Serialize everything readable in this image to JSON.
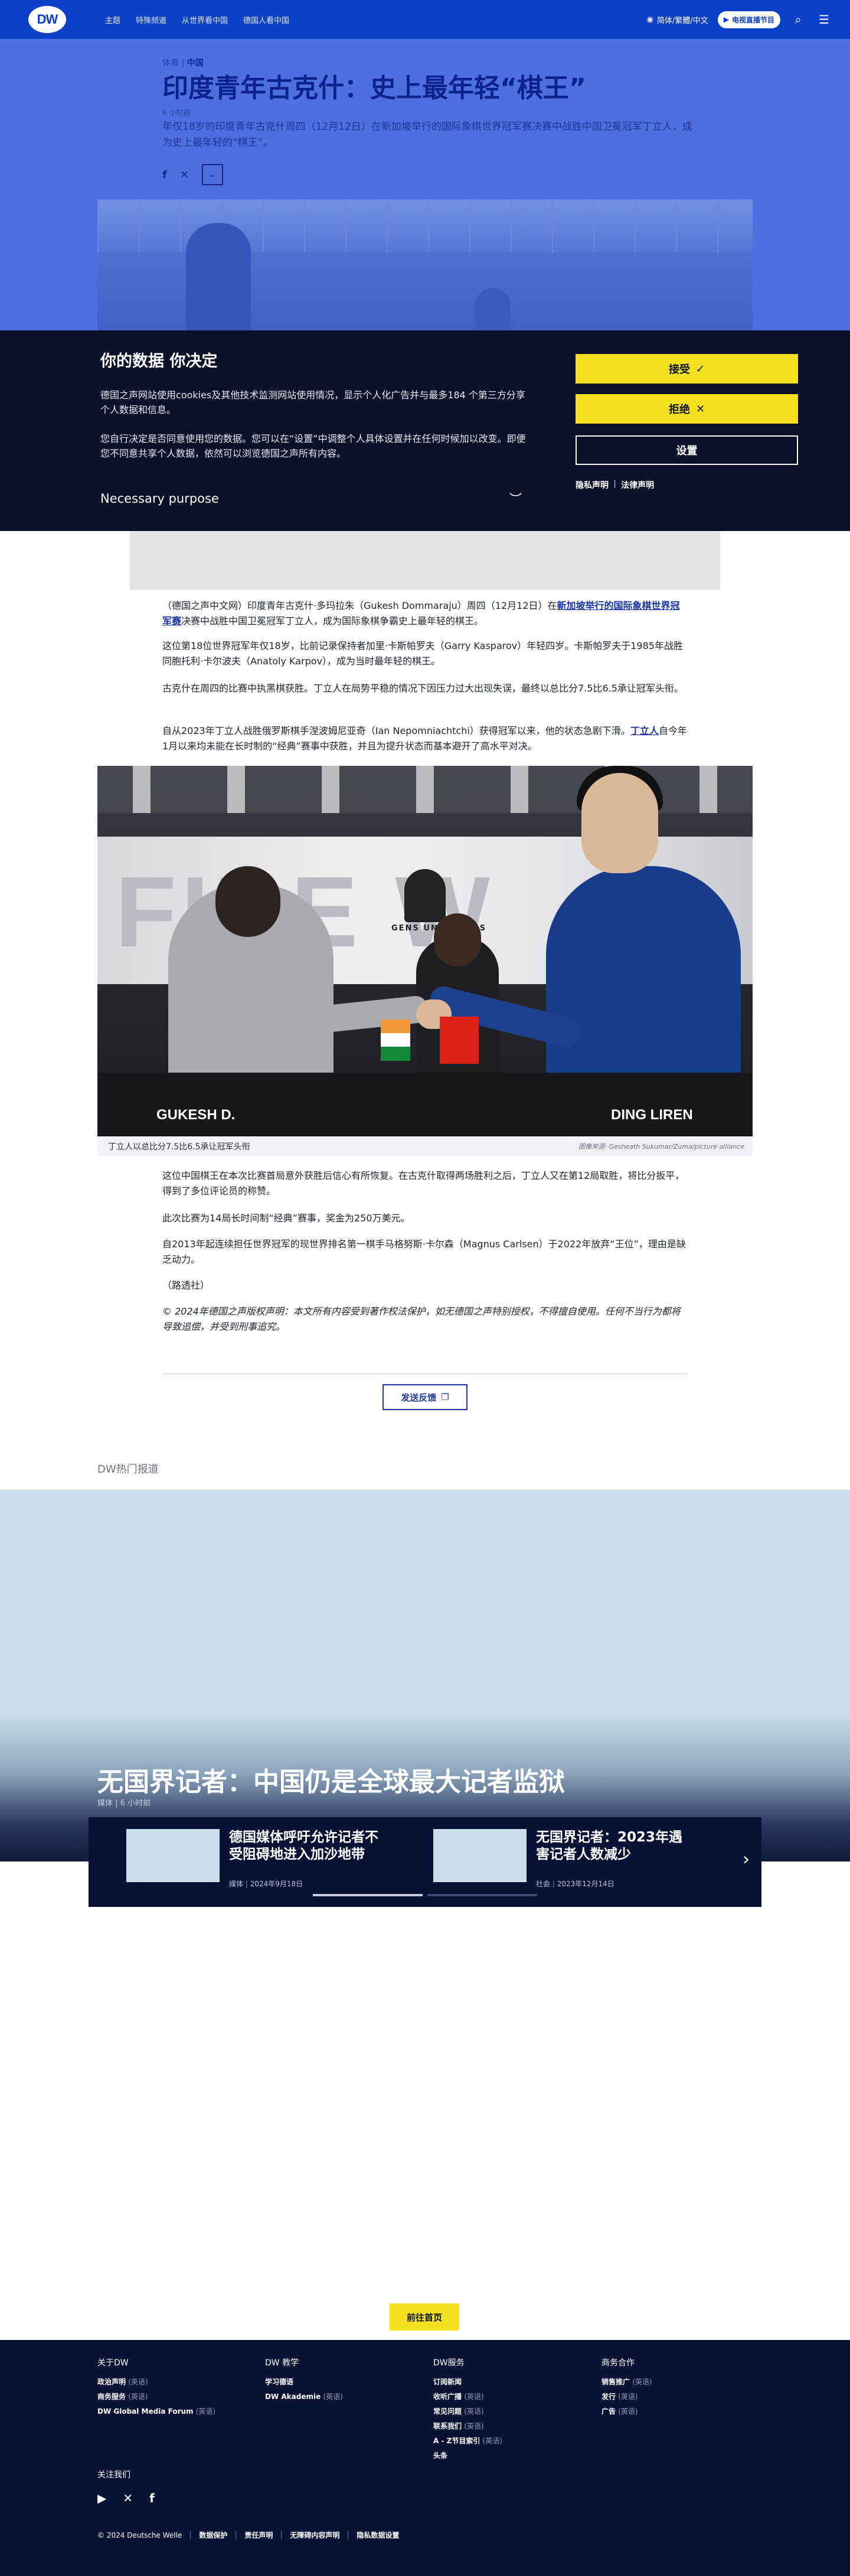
{
  "header": {
    "logo": "DW",
    "nav": [
      "主题",
      "特殊频道",
      "从世界看中国",
      "德国人看中国"
    ],
    "lang_label": "简体/繁體/中文",
    "tv_label": "电视直播节目",
    "search_icon": "search-icon",
    "menu_icon": "menu-icon"
  },
  "article": {
    "category": "体育",
    "region": "中国",
    "title": "印度青年古克什：史上最年轻“棋王”",
    "time": "6 小时前",
    "lead": "年仅18岁的印度青年古克什周四（12月12日）在新加坡举行的国际象棋世界冠军赛决赛中战胜中国卫冕冠军丁立人，成为史上最年轻的“棋王”。"
  },
  "cookie": {
    "title": "你的数据 你决定",
    "p1": "德国之声网站使用cookies及其他技术监测网站使用情况，显示个人化广告并与最多184 个第三方分享个人数据和信息。",
    "p2": "您自行决定是否同意使用您的数据。您可以在“设置”中调整个人具体设置并在任何时候加以改变。即便您不同意共享个人数据，依然可以浏览德国之声所有内容。",
    "purpose": "Necessary purpose",
    "accept": "接受",
    "reject": "拒绝",
    "settings": "设置",
    "privacy": "隐私声明",
    "legal": "法律声明"
  },
  "body": {
    "p1_a": "（德国之声中文网）印度青年古克什·多玛拉朱（Gukesh Dommaraju）周四（12月12日）在",
    "p1_link": "新加坡举行的国际象棋世界冠军赛",
    "p1_b": "决赛中战胜中国卫冕冠军丁立人，成为国际象棋争霸史上最年轻的棋王。",
    "p2": "这位第18位世界冠军年仅18岁，比前记录保持者加里·卡斯帕罗夫（Garry Kasparov）年轻四岁。卡斯帕罗夫于1985年战胜同胞托利·卡尔波夫（Anatoly Karpov），成为当时最年轻的棋王。",
    "p3": "古克什在周四的比赛中执黑棋获胜。丁立人在局势平稳的情况下因压力过大出现失误，最终以总比分7.5比6.5承让冠军头衔。",
    "p4_a": "自从2023年丁立人战胜俄罗斯棋手涅波姆尼亚奇（Ian Nepomniachtchi）获得冠军以来，他的状态急剧下滑。",
    "p4_link": "丁立人",
    "p4_b": "自今年1月以来均未能在长时制的“经典”赛事中获胜，并且为提升状态而基本避开了高水平对决。",
    "caption": "丁立人以总比分7.5比6.5承让冠军头衔",
    "credit": "图像来源: Gesheath Sukumar/Zuma/picture alliance",
    "photo_name_left": "GUKESH D.",
    "photo_name_right": "DING LIREN",
    "photo_text": "FIDE",
    "photo_motto": "GENS UNA SUMUS",
    "p5": "这位中国棋王在本次比赛首局意外获胜后信心有所恢复。在古克什取得两场胜利之后，丁立人又在第12局取胜，将比分扳平，得到了多位评论员的称赞。",
    "p6": "此次比赛为14局长时间制“经典”赛事，奖金为250万美元。",
    "p7": "自2013年起连续担任世界冠军的现世界排名第一棋手马格努斯·卡尔森（Magnus Carlsen）于2022年放弃“王位”，理由是缺乏动力。",
    "p8": "（路透社）",
    "p9": "© 2024年德国之声版权声明：本文所有内容受到著作权法保护，如无德国之声特别授权，不得擅自使用。任何不当行为都将导致追偿，并受到刑事追究。",
    "feedback": "发送反馈"
  },
  "hot": {
    "heading": "DW热门报道",
    "title": "无国界记者：中国仍是全球最大记者监狱",
    "meta_a": "媒体",
    "meta_b": "6 小时前",
    "cards": [
      {
        "title": "德国媒体呼吁允许记者不受阻碍地进入加沙地带",
        "meta_a": "媒体",
        "meta_b": "2024年9月18日"
      },
      {
        "title": "无国界记者：2023年遇害记者人数减少",
        "meta_a": "社会",
        "meta_b": "2023年12月14日"
      }
    ]
  },
  "home_button": "前往首页",
  "footer": {
    "cols": [
      {
        "title": "关于DW",
        "items": [
          [
            "政治声明",
            "(英语)"
          ],
          [
            "商务服务",
            "(英语)"
          ],
          [
            "DW Global Media Forum",
            "(英语)"
          ]
        ]
      },
      {
        "title": "DW 教学",
        "items": [
          [
            "学习德语",
            ""
          ],
          [
            "DW Akademie",
            "(英语)"
          ]
        ]
      },
      {
        "title": "DW服务",
        "items": [
          [
            "订阅新闻",
            ""
          ],
          [
            "收听广播",
            "(英语)"
          ],
          [
            "常见问题",
            "(英语)"
          ],
          [
            "联系我们",
            "(英语)"
          ],
          [
            "A - Z节目索引",
            "(英语)"
          ],
          [
            "头条",
            ""
          ]
        ]
      },
      {
        "title": "商务合作",
        "items": [
          [
            "销售推广",
            "(英语)"
          ],
          [
            "发行",
            "(英语)"
          ],
          [
            "广告",
            "(英语)"
          ]
        ]
      }
    ],
    "follow": "关注我们",
    "social": [
      "youtube-icon",
      "x-icon",
      "facebook-icon"
    ],
    "copyright": "© 2024 Deutsche Welle",
    "links": [
      "数据保护",
      "责任声明",
      "无障碍内容声明",
      "隐私数据设置"
    ]
  }
}
